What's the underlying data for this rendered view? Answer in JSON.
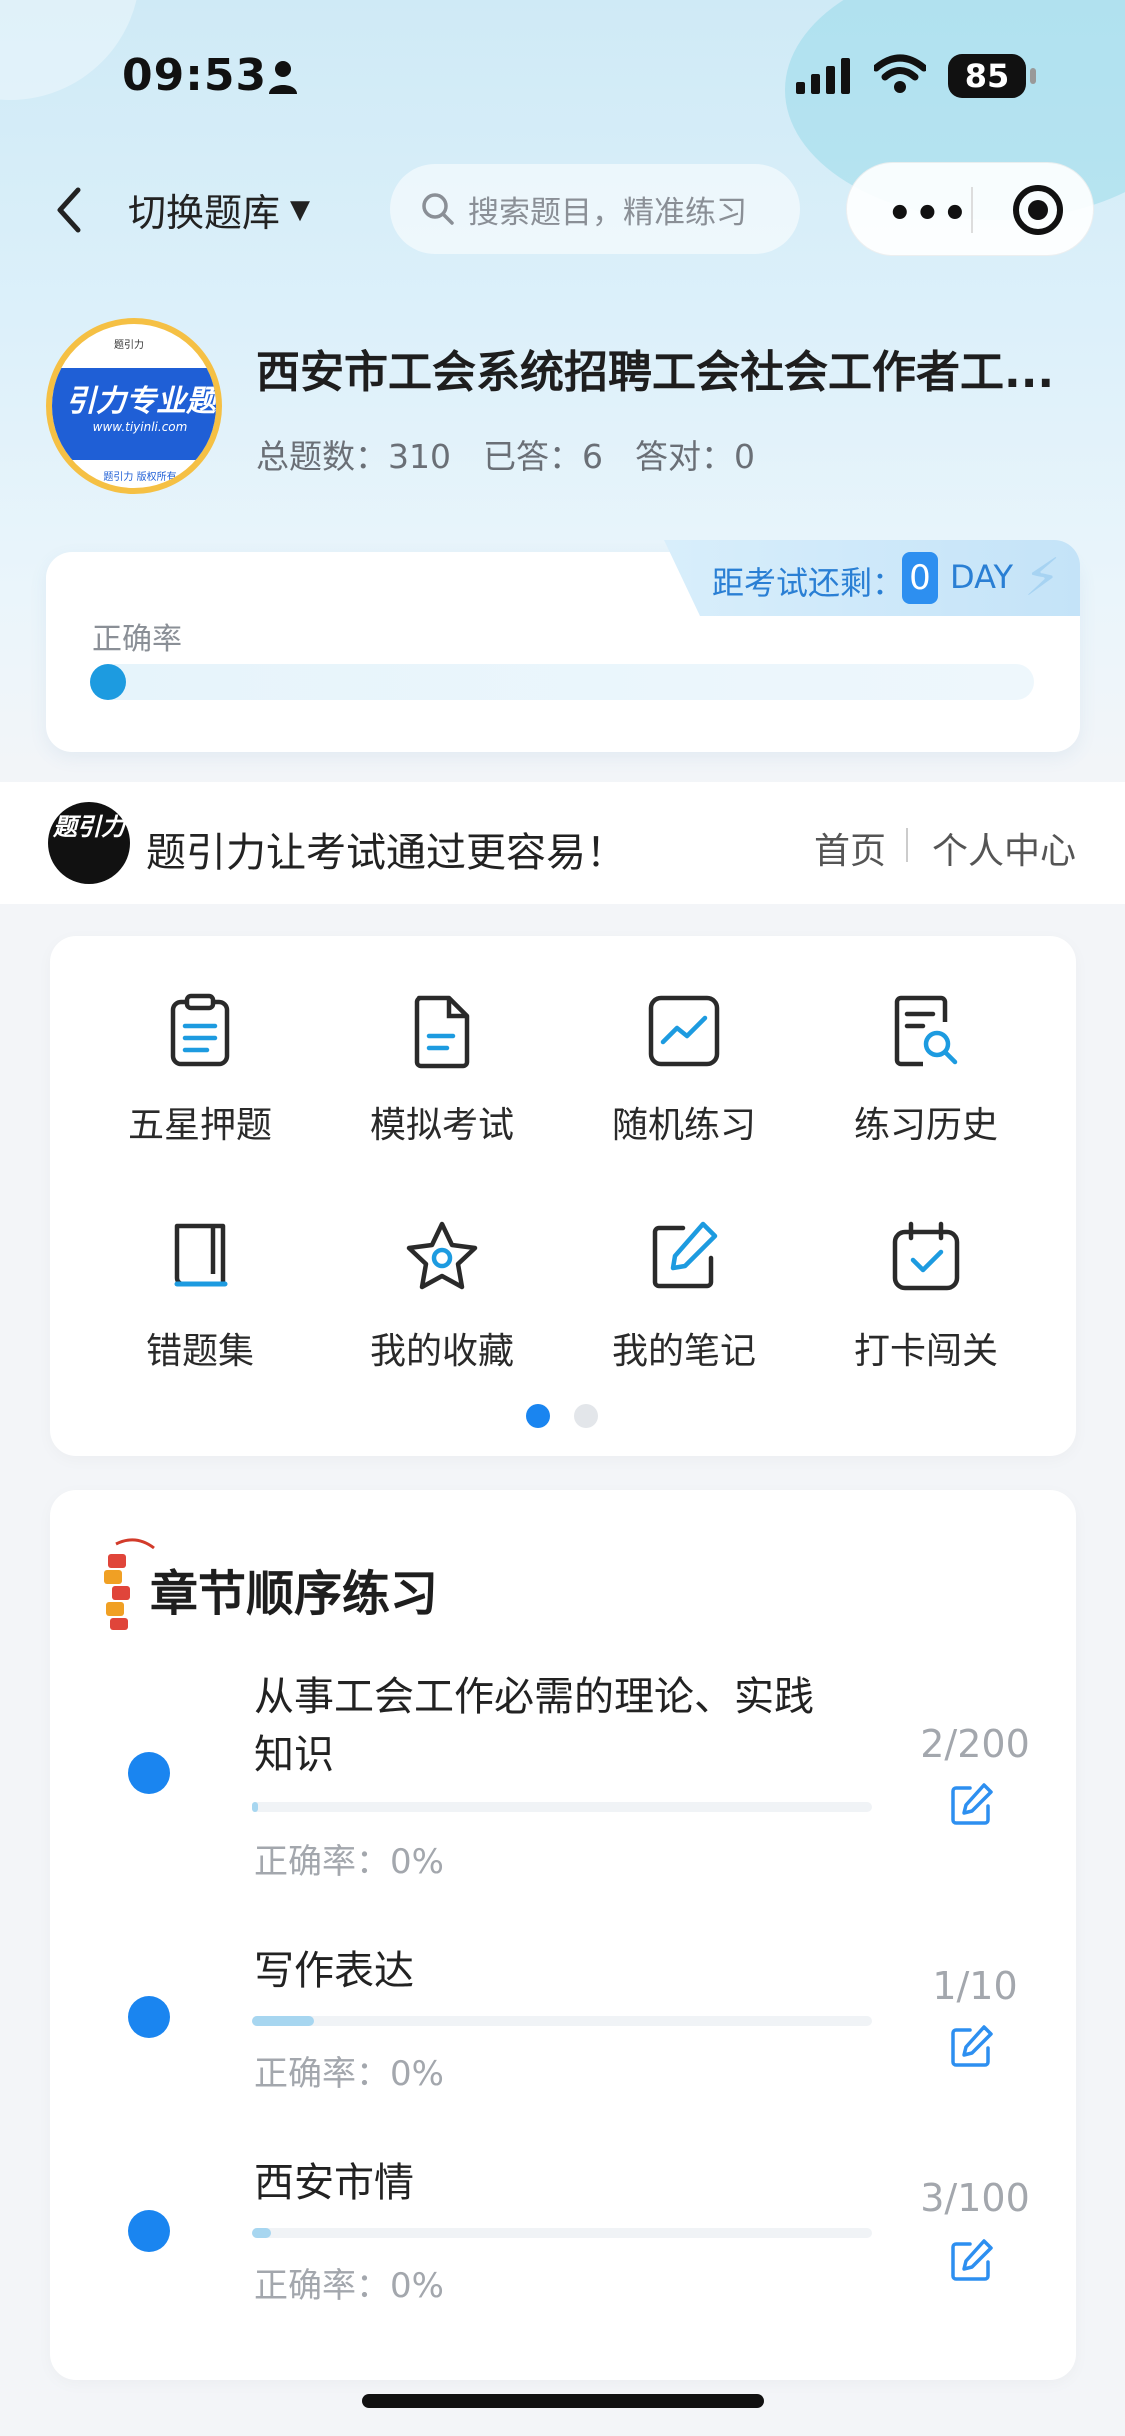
{
  "status_bar": {
    "time": "09:53",
    "battery": "85"
  },
  "nav": {
    "back_icon": "chevron-left-icon",
    "switch_label": "切换题库",
    "search_placeholder": "搜索题目，精准练习"
  },
  "header": {
    "logo": {
      "band_text": "引力专业题",
      "url": "www.tiyinli.com",
      "footer": "题引力 版权所有",
      "topmark": "题引力"
    },
    "title": "西安市工会系统招聘工会社会工作者工...",
    "stats": {
      "total": "总题数：310",
      "answered": "已答：6",
      "correct": "答对：0"
    }
  },
  "accuracy": {
    "label": "正确率",
    "countdown_label": "距考试还剩：",
    "countdown_value": "0",
    "countdown_unit": "DAY",
    "progress": 0.02,
    "accent": "#1d9be0"
  },
  "banner": {
    "logo_text": "题引力",
    "slogan": "题引力让考试通过更容易！",
    "home": "首页",
    "profile": "个人中心"
  },
  "features": [
    {
      "label": "五星押题",
      "icon": "clipboard-list-icon"
    },
    {
      "label": "模拟考试",
      "icon": "document-icon"
    },
    {
      "label": "随机练习",
      "icon": "chart-line-icon"
    },
    {
      "label": "练习历史",
      "icon": "history-search-icon"
    },
    {
      "label": "错题集",
      "icon": "book-icon"
    },
    {
      "label": "我的收藏",
      "icon": "star-icon"
    },
    {
      "label": "我的笔记",
      "icon": "edit-note-icon"
    },
    {
      "label": "打卡闯关",
      "icon": "calendar-check-icon"
    }
  ],
  "pager": {
    "active_color": "#1a85f0",
    "inactive_color": "#e3e6ea"
  },
  "chapters": {
    "title": "章节顺序练习",
    "items": [
      {
        "name_line1": "从事工会工作必需的理论、实践",
        "name_line2": "知识",
        "accuracy": "正确率：0%",
        "count": "2/200",
        "progress": 0.01
      },
      {
        "name_line1": "写作表达",
        "name_line2": "",
        "accuracy": "正确率：0%",
        "count": "1/10",
        "progress": 0.1
      },
      {
        "name_line1": "西安市情",
        "name_line2": "",
        "accuracy": "正确率：0%",
        "count": "3/100",
        "progress": 0.03
      }
    ]
  }
}
